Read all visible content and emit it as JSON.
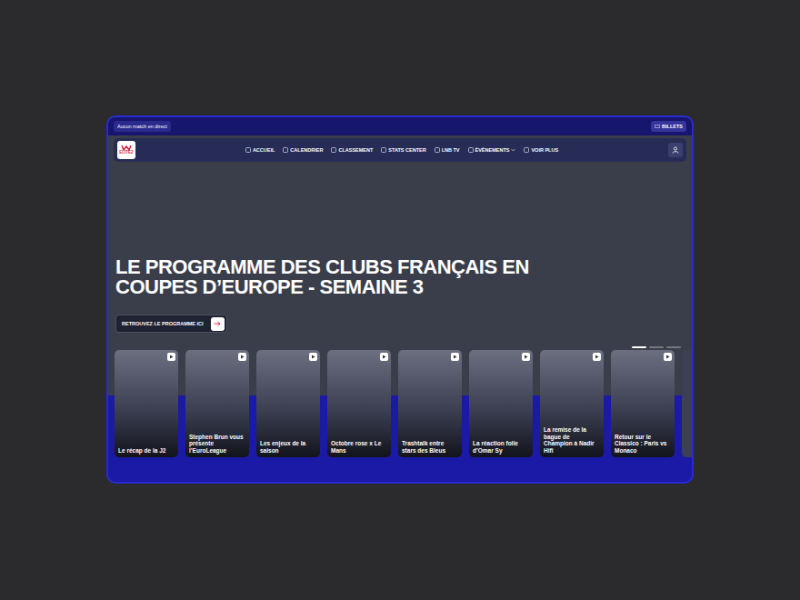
{
  "status_bar": {
    "live": "Aucun match en direct",
    "tickets": "BILLETS"
  },
  "logo": "ELITE2",
  "nav": [
    {
      "label": "ACCUEIL",
      "kind": "link"
    },
    {
      "label": "CALENDRIER",
      "kind": "link"
    },
    {
      "label": "CLASSEMENT",
      "kind": "link"
    },
    {
      "label": "STATS CENTER",
      "kind": "link"
    },
    {
      "label": "LNB TV",
      "kind": "link"
    },
    {
      "label": "ÉVÉNEMENTS",
      "kind": "dropdown"
    },
    {
      "label": "VOIR PLUS",
      "kind": "link"
    }
  ],
  "hero": {
    "title": "LE PROGRAMME DES CLUBS FRANÇAIS EN COUPES D’EUROPE - SEMAINE 3",
    "cta": "RETROUVEZ LE PROGRAMME ICI",
    "slides": [
      {
        "selected": true
      },
      {
        "selected": false
      },
      {
        "selected": false
      }
    ]
  },
  "stories": [
    {
      "title": "Le récap de la J2"
    },
    {
      "title": "Stephen Brun vous présente l’EuroLeague"
    },
    {
      "title": "Les enjeux de la saison"
    },
    {
      "title": "Octobre rose x Le Mans"
    },
    {
      "title": "Trashtalk entre stars des Bleus"
    },
    {
      "title": "La réaction folle d’Omar Sy"
    },
    {
      "title": "La remise de la bague de Champion à Nadir Hifi"
    },
    {
      "title": "Retour sur le Classico : Paris vs Monaco"
    }
  ]
}
